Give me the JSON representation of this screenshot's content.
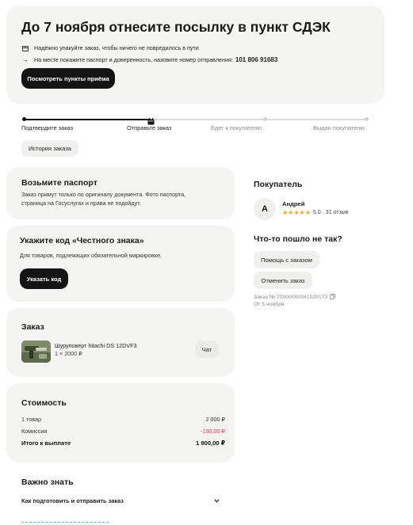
{
  "banner": {
    "title": "До 7 ноября отнесите посылку в пункт СДЭК",
    "note1": "Надёжно упакуйте заказ, чтобы ничего не повредилось в пути",
    "note2": "На месте покажите паспорт и доверенность, назовите номер отправления:",
    "tracking_number": "101 806 91683",
    "button_label": "Посмотреть пункты приёма"
  },
  "progress": {
    "steps": [
      "Подтвердите заказ",
      "Отправьте заказ",
      "Едет к покупателю",
      "Выдан покупателю"
    ],
    "current_step": 2,
    "history_button": "История заказа"
  },
  "passport_card": {
    "title": "Возьмите паспорт",
    "text": "Заказ примут только по оригиналу документа. Фото паспорта, страница на Госуслугах и права не подойдут."
  },
  "honest_sign_card": {
    "title": "Укажите код «Честного знака»",
    "text": "Для товаров, подлежащих обязательной маркировке.",
    "button_label": "Указать код"
  },
  "order_card": {
    "title": "Заказ",
    "item_name": "Шуруповерт hitachi DS 12DVF3",
    "item_qty_price": "1 × 2000 ₽",
    "chat_button": "Чат"
  },
  "cost_card": {
    "title": "Стоимость",
    "rows": [
      {
        "label": "1 товар",
        "value": "2 000 ₽"
      },
      {
        "label": "Комиссия",
        "value": "-100,00 ₽"
      }
    ],
    "total_label": "Итого к выплате",
    "total_value": "1 900,00 ₽"
  },
  "important": {
    "title": "Важно знать",
    "item1": "Как подготовить и отправить заказ"
  },
  "buyer": {
    "title": "Покупатель",
    "avatar_letter": "А",
    "name": "Андрей",
    "stars": "★★★★★",
    "rating": "5.0 · 31 отзыв"
  },
  "problem": {
    "title": "Что-то пошло не так?",
    "help_button": "Помощь с заказом",
    "cancel_button": "Отменить заказ",
    "order_number": "Заказ № 70000000341029173",
    "order_date": "От 5 ноября"
  },
  "colors": {
    "accent": "#141414",
    "card_bg": "#f4f4f2",
    "star": "#f5a623",
    "negative": "#e2455a",
    "link": "#1e88e5"
  }
}
